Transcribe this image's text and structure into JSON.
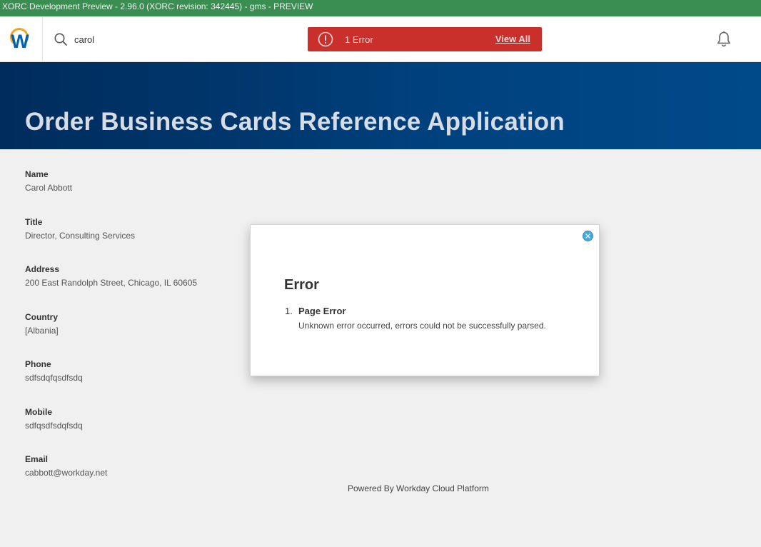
{
  "preview_banner": "XORC Development Preview - 2.96.0 (XORC revision: 342445) - gms - PREVIEW",
  "header": {
    "logo_letter": "W",
    "logo_colors": {
      "arc": "#f6a21e",
      "letter": "#0063b0"
    },
    "search_value": "carol",
    "error_pill": {
      "label": "1 Error",
      "link": "View All",
      "color": "#c9302c"
    },
    "icons": [
      "workday-logo-icon",
      "search-icon",
      "error-icon",
      "bell-icon"
    ]
  },
  "page": {
    "title": "Order Business Cards Reference Application",
    "fields": [
      {
        "label": "Name",
        "value": "Carol Abbott"
      },
      {
        "label": "Title",
        "value": "Director, Consulting Services"
      },
      {
        "label": "Address",
        "value": "200 East Randolph Street, Chicago, IL 60605"
      },
      {
        "label": "Country",
        "value": "[Albania]"
      },
      {
        "label": "Phone",
        "value": "sdfsdqfqsdfsdq"
      },
      {
        "label": "Mobile",
        "value": "sdfqsdfsdqfsdq"
      },
      {
        "label": "Email",
        "value": "cabbott@workday.net"
      }
    ],
    "footer": "Powered By Workday Cloud Platform"
  },
  "modal": {
    "title": "Error",
    "errors": [
      {
        "number": "1.",
        "heading": "Page Error",
        "message": "Unknown error occurred, errors could not be successfully parsed."
      }
    ],
    "close_icon": "close-icon"
  }
}
